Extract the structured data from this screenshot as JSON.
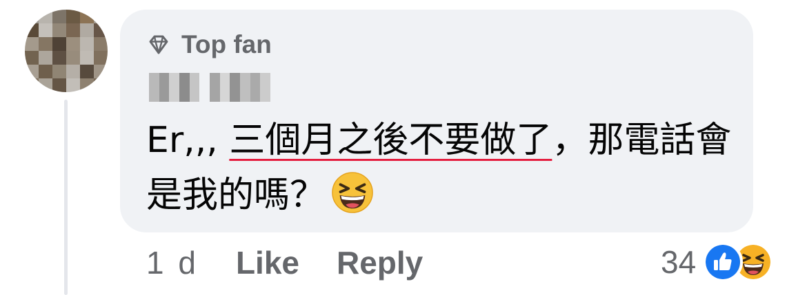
{
  "comment": {
    "badge_icon": "diamond-icon",
    "badge_label": "Top fan",
    "author_name": "",
    "text_prefix": "Er,,, ",
    "text_underlined": "三個月之後不要做了",
    "text_suffix": "，那電話會是我的嗎？",
    "emoji": "grinning-squinting-face-icon"
  },
  "actions": {
    "time": "1 d",
    "like_label": "Like",
    "reply_label": "Reply"
  },
  "reactions": {
    "count": "34",
    "icons": [
      "like-reaction-icon",
      "haha-reaction-icon"
    ]
  },
  "colors": {
    "bubble_bg": "#f0f2f5",
    "secondary_text": "#65676b",
    "primary_text": "#050505",
    "underline": "#e41e3f",
    "like_blue": "#1877f2",
    "haha_yellow": "#f7b125"
  }
}
